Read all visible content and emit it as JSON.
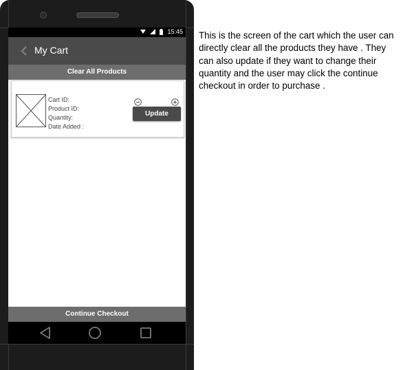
{
  "status_bar": {
    "time": "15:45"
  },
  "app_bar": {
    "title": "My Cart"
  },
  "actions": {
    "clear_all": "Clear All Products",
    "continue_checkout": "Continue Checkout"
  },
  "cart_item": {
    "labels": [
      "Cart ID:",
      "Product ID:",
      "Quantity:",
      "Date Added :"
    ],
    "update_label": "Update"
  },
  "annotation": {
    "text": "This is the screen of the cart which the user can directly clear all the products they have . They can also update if they want to change their quantity and the user may click the continue checkout in order to purchase ."
  },
  "colors": {
    "app_bar": "#4a4a4a",
    "action_bar": "#6d6d6d",
    "device": "#1c1c1c"
  }
}
